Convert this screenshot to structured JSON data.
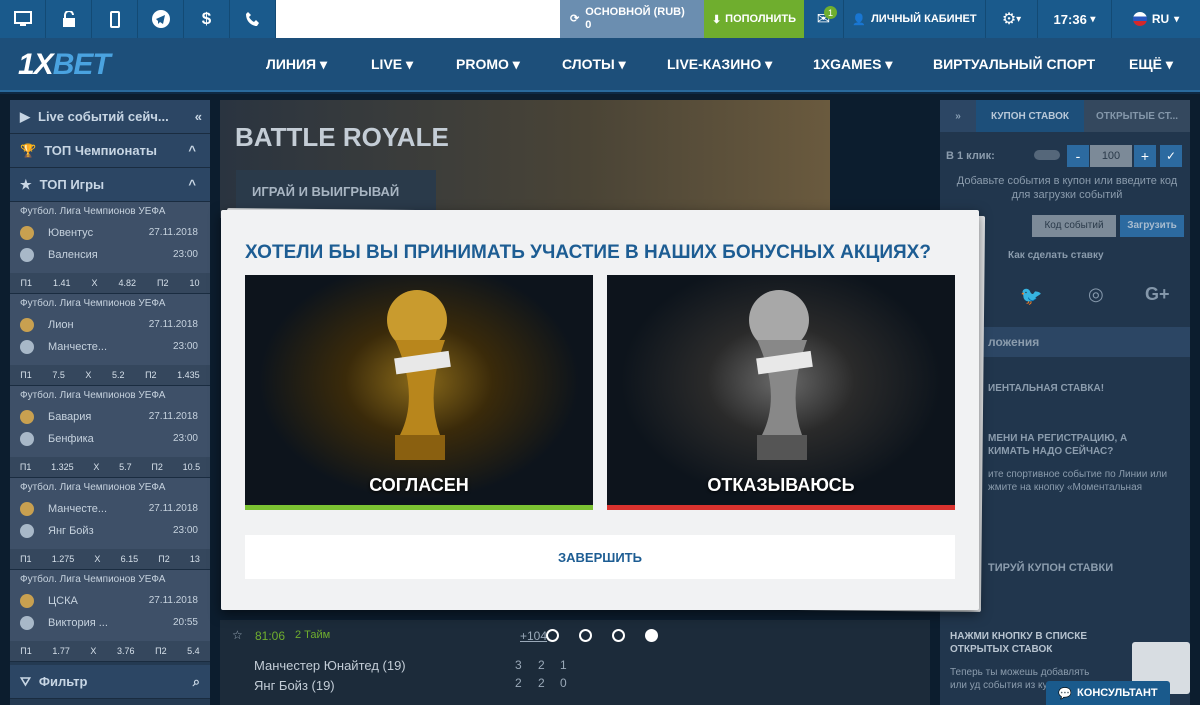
{
  "topbar": {
    "balance_label": "ОСНОВНОЙ (RUB)",
    "balance_value": "0",
    "deposit": "ПОПОЛНИТЬ",
    "messages_count": "1",
    "cabinet": "ЛИЧНЫЙ КАБИНЕТ",
    "time": "17:36",
    "lang": "RU"
  },
  "nav": {
    "logo_a": "1X",
    "logo_b": "BET",
    "items": [
      "ЛИНИЯ",
      "LIVE",
      "PROMO",
      "СЛОТЫ",
      "LIVE-КАЗИНО",
      "1XGAMES",
      "ВИРТУАЛЬНЫЙ СПОРТ",
      "ЕЩЁ"
    ]
  },
  "left": {
    "live_events": "Live событий сейч...",
    "top_champs": "ТОП Чемпионаты",
    "top_games": "ТОП Игры",
    "filter": "Фильтр",
    "matches": [
      {
        "league": "Футбол. Лига Чемпионов УЕФА",
        "t1": "Ювентус",
        "t2": "Валенсия",
        "date": "27.11.2018",
        "time": "23:00",
        "o": [
          "П1",
          "1.41",
          "X",
          "4.82",
          "П2",
          "10"
        ]
      },
      {
        "league": "Футбол. Лига Чемпионов УЕФА",
        "t1": "Лион",
        "t2": "Манчесте...",
        "date": "27.11.2018",
        "time": "23:00",
        "o": [
          "П1",
          "7.5",
          "X",
          "5.2",
          "П2",
          "1.435"
        ]
      },
      {
        "league": "Футбол. Лига Чемпионов УЕФА",
        "t1": "Бавария",
        "t2": "Бенфика",
        "date": "27.11.2018",
        "time": "23:00",
        "o": [
          "П1",
          "1.325",
          "X",
          "5.7",
          "П2",
          "10.5"
        ]
      },
      {
        "league": "Футбол. Лига Чемпионов УЕФА",
        "t1": "Манчесте...",
        "t2": "Янг Бойз",
        "date": "27.11.2018",
        "time": "23:00",
        "o": [
          "П1",
          "1.275",
          "X",
          "6.15",
          "П2",
          "13"
        ]
      },
      {
        "league": "Футбол. Лига Чемпионов УЕФА",
        "t1": "ЦСКА",
        "t2": "Виктория ...",
        "date": "27.11.2018",
        "time": "20:55",
        "o": [
          "П1",
          "1.77",
          "X",
          "3.76",
          "П2",
          "5.4"
        ]
      }
    ]
  },
  "hero": {
    "title": "BATTLE ROYALE",
    "subtitle": "ИГРАЙ И ВЫИГРЫВАЙ"
  },
  "right": {
    "tab1": "КУПОН СТАВОК",
    "tab2": "ОТКРЫТЫЕ СТ...",
    "one_click": "В 1 клик:",
    "amount": "100",
    "hint": "Добавьте события в купон или введите код для загрузки событий",
    "code_placeholder": "Код событий",
    "load": "Загрузить",
    "how_to": "Как сделать ставку",
    "section1": "ложения",
    "promo1": "ИЕНТАЛЬНАЯ СТАВКА!",
    "promo2": "МЕНИ НА РЕГИСТРАЦИЮ, А КИМАТЬ НАДО СЕЙЧАС?",
    "promo3": "ите спортивное событие по Линии или жмите на кнопку «Моментальная",
    "promo4": "ТИРУЙ КУПОН СТАВКИ",
    "promo5": "НАЖМИ КНОПКУ В СПИСКЕ ОТКРЫТЫХ СТАВОК",
    "promo6": "Теперь ты можешь добавлять или уд события из купона",
    "consultant": "КОНСУЛЬТАНТ"
  },
  "table": {
    "live_time": "81:06",
    "half": "2 Тайм",
    "more": "+104",
    "team1": "Манчестер Юнайтед (19)",
    "team2": "Янг Бойз (19)",
    "s1": [
      "3",
      "2",
      "1"
    ],
    "s2": [
      "2",
      "2",
      "0"
    ]
  },
  "modal": {
    "title": "ХОТЕЛИ БЫ ВЫ ПРИНИМАТЬ УЧАСТИЕ В НАШИХ БОНУСНЫХ АКЦИЯХ?",
    "agree": "СОГЛАСЕН",
    "decline": "ОТКАЗЫВАЮСЬ",
    "finish": "ЗАВЕРШИТЬ"
  },
  "colors": {
    "accent": "#1d5d93",
    "agree_bar": "#7bc232",
    "decline_bar": "#d9322e",
    "deposit": "#6fae2e"
  }
}
